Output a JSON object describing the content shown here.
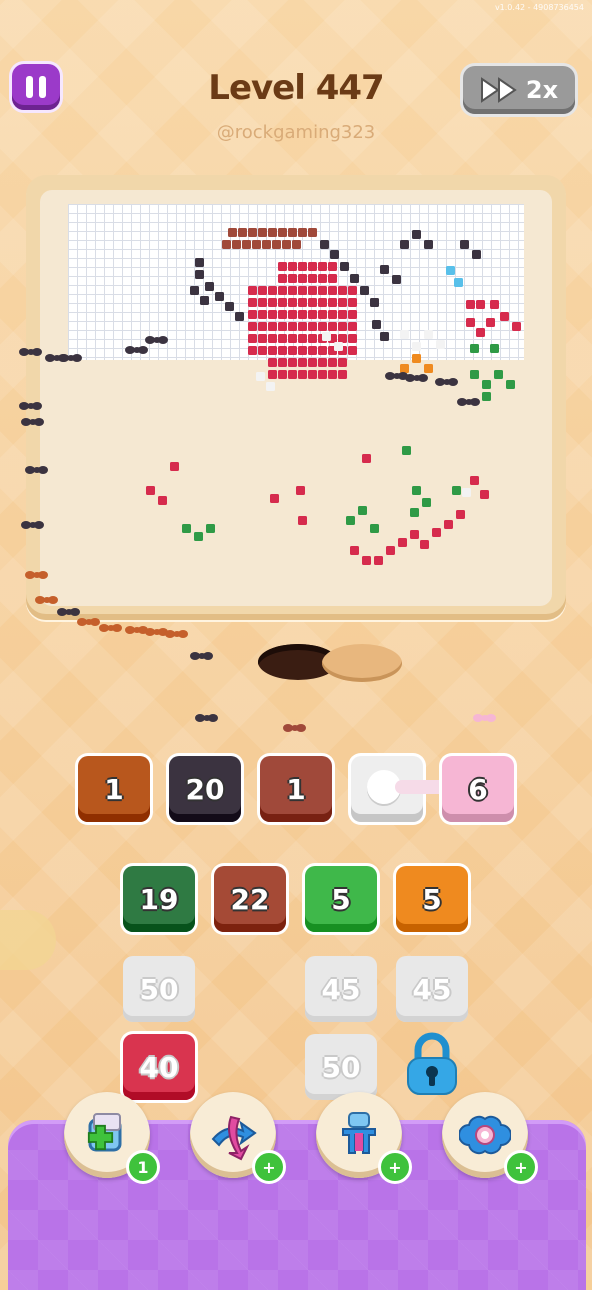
{
  "version": "v1.0.42 - 4908736454",
  "header": {
    "level_label": "Level 447",
    "speed_label": "2x",
    "watermark": "@rockgaming323"
  },
  "colors": {
    "orange_brown": "#b8571d",
    "dark": "#3b3340",
    "brown": "#a0493a",
    "white": "#eeeeee",
    "pink": "#f6b6d4",
    "dark_green": "#2f7a43",
    "brick": "#a54a36",
    "green": "#3fb84a",
    "orange": "#ef8a1f",
    "red": "#d9344f",
    "locked_grey": "#e8e8e8"
  },
  "queue_row": [
    {
      "value": "1",
      "color": "orange_brown"
    },
    {
      "value": "20",
      "color": "dark"
    },
    {
      "value": "1",
      "color": "brown"
    },
    {
      "value": "",
      "color": "white"
    },
    {
      "value": "6",
      "color": "pink"
    }
  ],
  "tile_grid": [
    {
      "value": "19",
      "color": "dark_green",
      "state": "active"
    },
    {
      "value": "22",
      "color": "brick",
      "state": "active"
    },
    {
      "value": "5",
      "color": "green",
      "state": "active"
    },
    {
      "value": "5",
      "color": "orange",
      "state": "active"
    },
    {
      "value": "50",
      "state": "hidden"
    },
    {
      "value": "45",
      "state": "hidden"
    },
    {
      "value": "45",
      "state": "hidden"
    },
    {
      "value": "40",
      "color": "red",
      "state": "next"
    },
    {
      "value": "50",
      "state": "hidden"
    }
  ],
  "boosters": [
    {
      "icon": "add-box-icon",
      "badge": "1"
    },
    {
      "icon": "swap-arrows-icon",
      "badge": "+"
    },
    {
      "icon": "magnet-claw-icon",
      "badge": "+"
    },
    {
      "icon": "ring-piece-icon",
      "badge": "+"
    }
  ]
}
